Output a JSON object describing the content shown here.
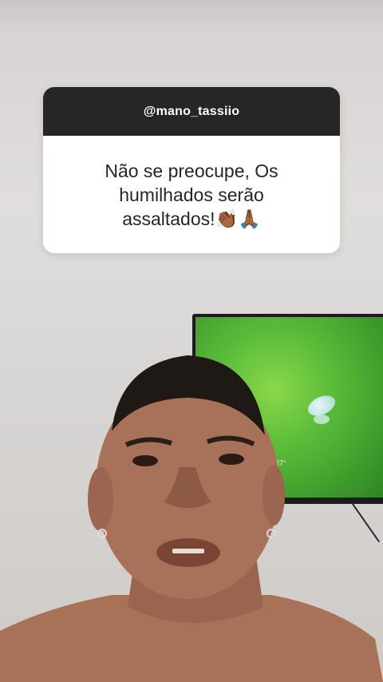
{
  "question_card": {
    "username": "@mano_tassiio",
    "question_text": "Não se preocupe, Os humilhados serão assaltados!👏🏾🙏🏾"
  },
  "background": {
    "tv_screen_readout": "27°"
  },
  "colors": {
    "card_header_bg": "#262626",
    "card_body_bg": "#ffffff",
    "tv_screen": "#5cbd3a"
  }
}
